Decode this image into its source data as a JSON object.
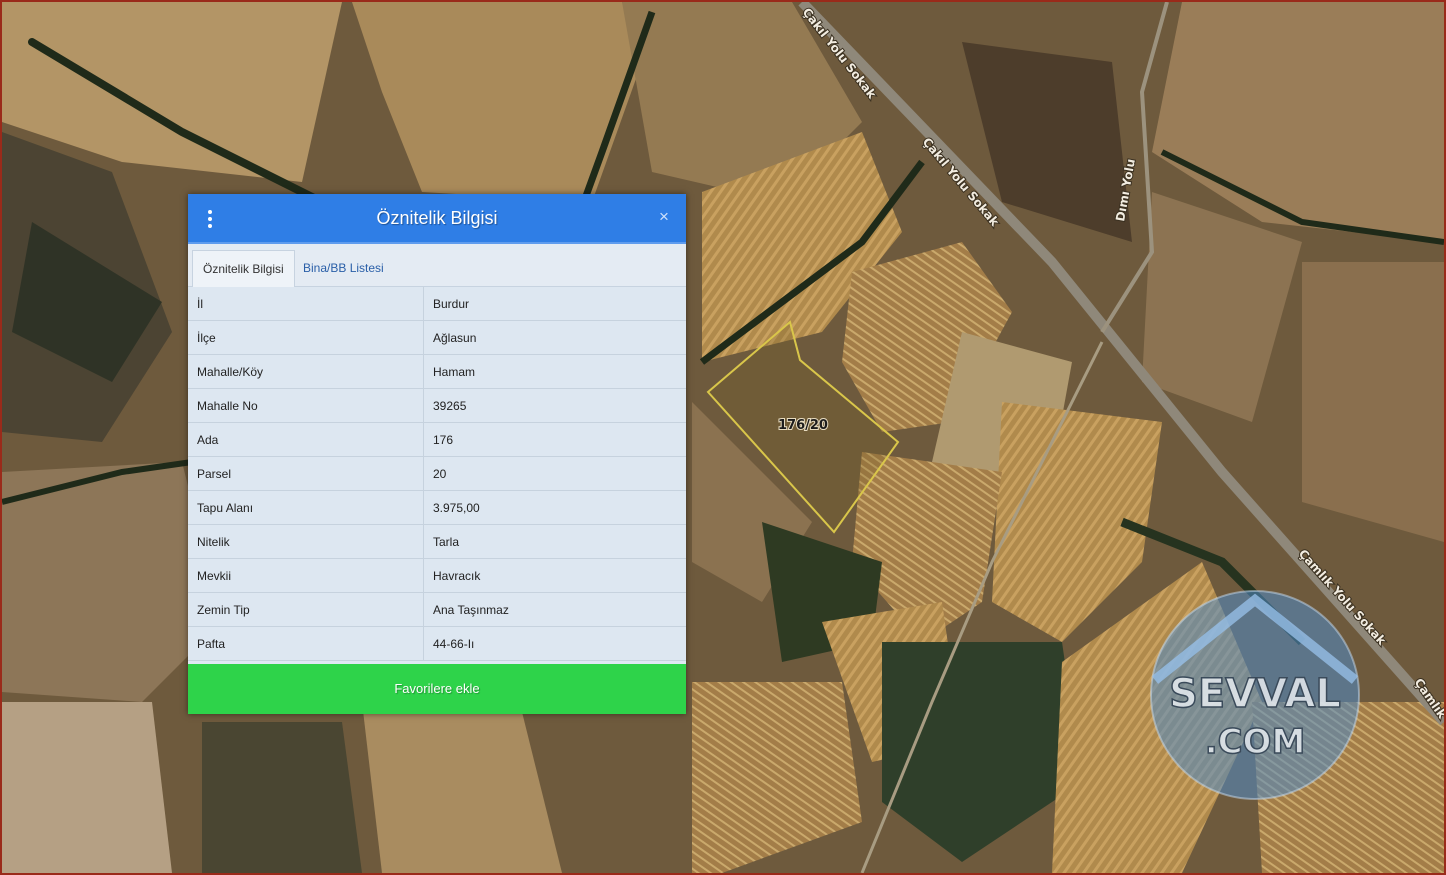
{
  "panel": {
    "title": "Öznitelik Bilgisi",
    "close_glyph": "×",
    "menu_icon": "more-vertical-icon",
    "tabs": [
      {
        "label": "Öznitelik Bilgisi",
        "active": true
      },
      {
        "label": "Bina/BB Listesi",
        "active": false
      }
    ],
    "rows": [
      {
        "key": "İl",
        "value": "Burdur"
      },
      {
        "key": "İlçe",
        "value": "Ağlasun"
      },
      {
        "key": "Mahalle/Köy",
        "value": "Hamam"
      },
      {
        "key": "Mahalle No",
        "value": "39265"
      },
      {
        "key": "Ada",
        "value": "176"
      },
      {
        "key": "Parsel",
        "value": "20"
      },
      {
        "key": "Tapu Alanı",
        "value": "3.975,00"
      },
      {
        "key": "Nitelik",
        "value": "Tarla"
      },
      {
        "key": "Mevkii",
        "value": "Havracık"
      },
      {
        "key": "Zemin Tip",
        "value": "Ana Taşınmaz"
      },
      {
        "key": "Pafta",
        "value": "44-66-Iı"
      }
    ],
    "favorite_button": "Favorilere ekle"
  },
  "map": {
    "parcel_label": "176/20",
    "road_labels": [
      "Çakıl Yolu Sokak",
      "Çakıl Yolu Sokak",
      "Dımı Yolu",
      "Çamlık Yolu Sokak",
      "Çamlık"
    ]
  },
  "watermark": {
    "line1": "SEVVAL",
    "line2": ".COM"
  },
  "colors": {
    "header": "#2f7ee6",
    "favorite": "#2ed34a",
    "parcel_outline": "#d9c64a"
  }
}
